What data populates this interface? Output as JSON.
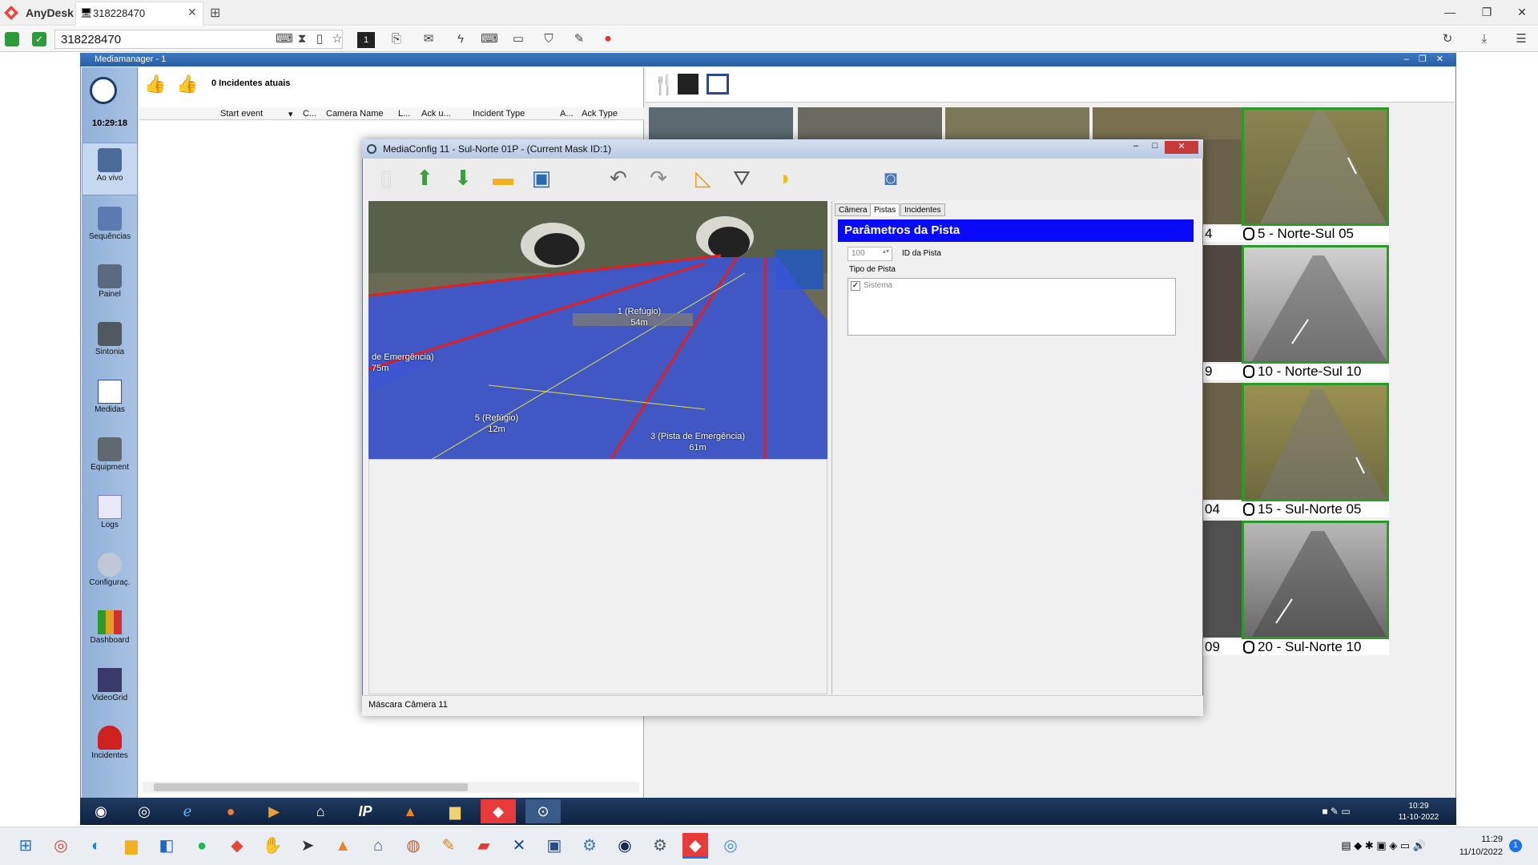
{
  "anydesk": {
    "app_name": "AnyDesk",
    "tab_label": "318228470",
    "address": "318228470",
    "session_badge": "1"
  },
  "mediamanager": {
    "title": "Mediamanager - 1",
    "clock": "10:29:18",
    "incidents": "0 Incidentes atuais",
    "nav": [
      "Ao vivo",
      "Sequências",
      "Painel",
      "Sintonia",
      "Medidas",
      "Equipment",
      "Logs",
      "Configuraç.",
      "Dashboard",
      "VideoGrid",
      "Incidentes"
    ],
    "columns": [
      "Start event",
      "C...",
      "Camera Name",
      "L...",
      "Ack u...",
      "Incident Type",
      "A...",
      "Ack Type"
    ]
  },
  "cameras": [
    {
      "label": "5 - Norte-Sul 05"
    },
    {
      "label": "10 - Norte-Sul 10"
    },
    {
      "label": "15 - Sul-Norte 05"
    },
    {
      "label": "20 - Sul-Norte 10"
    }
  ],
  "partial_labels": [
    "4",
    "9",
    "04",
    "09"
  ],
  "dialog": {
    "title": "MediaConfig 11 - Sul-Norte 01P - (Current Mask ID:1)",
    "tabs": [
      "Câmera",
      "Pistas",
      "Incidentes"
    ],
    "panel_title": "Parâmetros da Pista",
    "id_value": "100",
    "id_label": "ID da Pista",
    "tipo_label": "Tipo de Pista",
    "checkbox_label": "Sistema",
    "status": "Máscara Câmera 11",
    "lanes": [
      {
        "name": "1 (Refúgio)",
        "len": "54m"
      },
      {
        "name": "de Emergência)",
        "len": "75m"
      },
      {
        "name": "5 (Refúgio)",
        "len": "12m"
      },
      {
        "name": "3 (Pista de Emergência)",
        "len": "61m"
      }
    ]
  },
  "remote_clock": {
    "time": "10:29",
    "date": "11-10-2022"
  },
  "windows_clock": {
    "time": "11:29",
    "date": "11/10/2022",
    "badge": "1"
  },
  "colors": {
    "accent": "#0a0afa",
    "cam_border": "#2a9a2a",
    "lane": "#3a55d8"
  }
}
